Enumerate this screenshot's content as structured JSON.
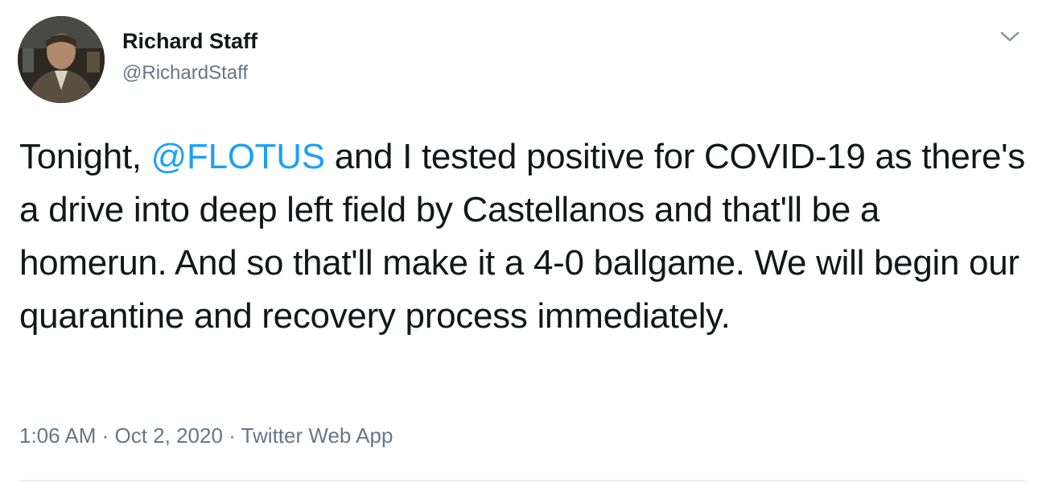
{
  "author": {
    "display_name": "Richard Staff",
    "handle": "@RichardStaff",
    "avatar_icon": "profile-photo"
  },
  "tweet": {
    "text_before": "Tonight, ",
    "mention": "@FLOTUS",
    "text_after": " and I tested positive for COVID-19 as there's a drive into deep left field by Castellanos and that'll be a homerun. And so that'll make it a 4-0 ballgame. We will begin our quarantine and recovery process immediately."
  },
  "meta": {
    "time": "1:06 AM",
    "separator": " · ",
    "date": "Oct 2, 2020",
    "source": "Twitter Web App"
  },
  "colors": {
    "mention": "#1da1f2",
    "secondary_text": "#657786",
    "primary_text": "#14171a"
  },
  "icons": {
    "menu": "chevron-down-icon"
  }
}
